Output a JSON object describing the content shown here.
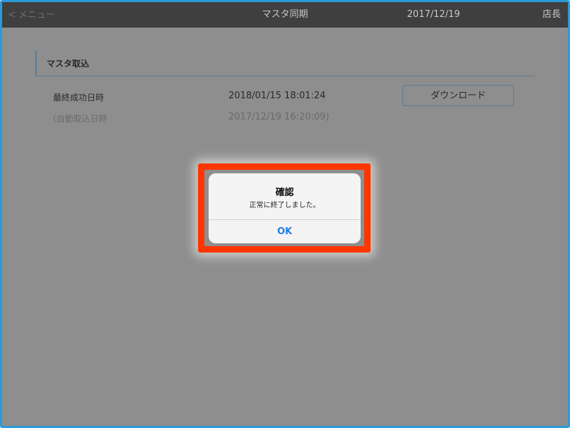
{
  "header": {
    "back_label": "メニュー",
    "back_chevron": "<",
    "title": "マスタ同期",
    "date": "2017/12/19",
    "role": "店長"
  },
  "section": {
    "title": "マスタ取込",
    "rows": [
      {
        "label": "最終成功日時",
        "value": "2018/01/15 18:01:24"
      },
      {
        "label": "(自動取込日時",
        "value": "2017/12/19 16:20:09)"
      }
    ],
    "download_label": "ダウンロード"
  },
  "dialog": {
    "title": "確認",
    "message": "正常に終了しました。",
    "ok_label": "OK"
  },
  "colors": {
    "highlight": "#ff3600",
    "accent_link": "#1f7fe0",
    "frame_border": "#2a9bd8"
  }
}
